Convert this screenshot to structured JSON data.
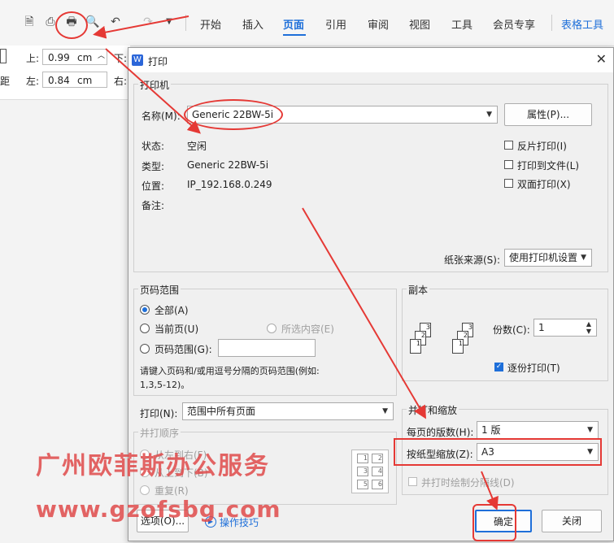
{
  "ribbon": {
    "tabs": [
      "开始",
      "插入",
      "页面",
      "引用",
      "审阅",
      "视图",
      "工具",
      "会员专享"
    ],
    "active_tab": "页面",
    "context_tab": "表格工具"
  },
  "margins": {
    "top_label": "上:",
    "top_value": "0.99",
    "top_unit": "cm",
    "left_label": "左:",
    "left_value": "0.84",
    "left_unit": "cm",
    "right_label": "下:",
    "bottom_label": "右:",
    "side_label": "距"
  },
  "dialog": {
    "title": "打印",
    "printer": {
      "group": "打印机",
      "name_label": "名称(M):",
      "name_value": "Generic 22BW-5i",
      "properties_button": "属性(P)...",
      "status_label": "状态:",
      "status_value": "空闲",
      "type_label": "类型:",
      "type_value": "Generic 22BW-5i",
      "location_label": "位置:",
      "location_value": "IP_192.168.0.249",
      "comment_label": "备注:",
      "reverse_print": "反片打印(I)",
      "print_to_file": "打印到文件(L)",
      "duplex": "双面打印(X)",
      "paper_source_label": "纸张来源(S):",
      "paper_source_value": "使用打印机设置"
    },
    "page_range": {
      "group": "页码范围",
      "all": "全部(A)",
      "current": "当前页(U)",
      "selection": "所选内容(E)",
      "pages": "页码范围(G):",
      "hint": "请键入页码和/或用逗号分隔的页码范围(例如:",
      "hint2": "1,3,5-12)。"
    },
    "print_what": {
      "label": "打印(N):",
      "value": "范围中所有页面"
    },
    "order": {
      "group": "并打顺序",
      "left_to_right": "从左到右(F)",
      "top_to_bottom": "从上到下(B)",
      "repeat": "重复(R)"
    },
    "copies": {
      "group": "副本",
      "copies_label": "份数(C):",
      "copies_value": "1",
      "collate": "逐份打印(T)"
    },
    "zoom": {
      "group": "并打和缩放",
      "pages_per_sheet_label": "每页的版数(H):",
      "pages_per_sheet_value": "1 版",
      "scale_label": "按纸型缩放(Z):",
      "scale_value": "A3",
      "draw_lines": "并打时绘制分隔线(D)"
    },
    "options_button": "选项(O)...",
    "tips_link": "操作技巧",
    "ok_button": "确定",
    "close_button": "关闭"
  },
  "watermark": {
    "line1": "广州欧菲斯办公服务",
    "line2": "www.gzofsbg.com"
  },
  "colors": {
    "accent": "#1e6fd9",
    "annotation": "#e53935",
    "watermark": "#e04b4b"
  }
}
